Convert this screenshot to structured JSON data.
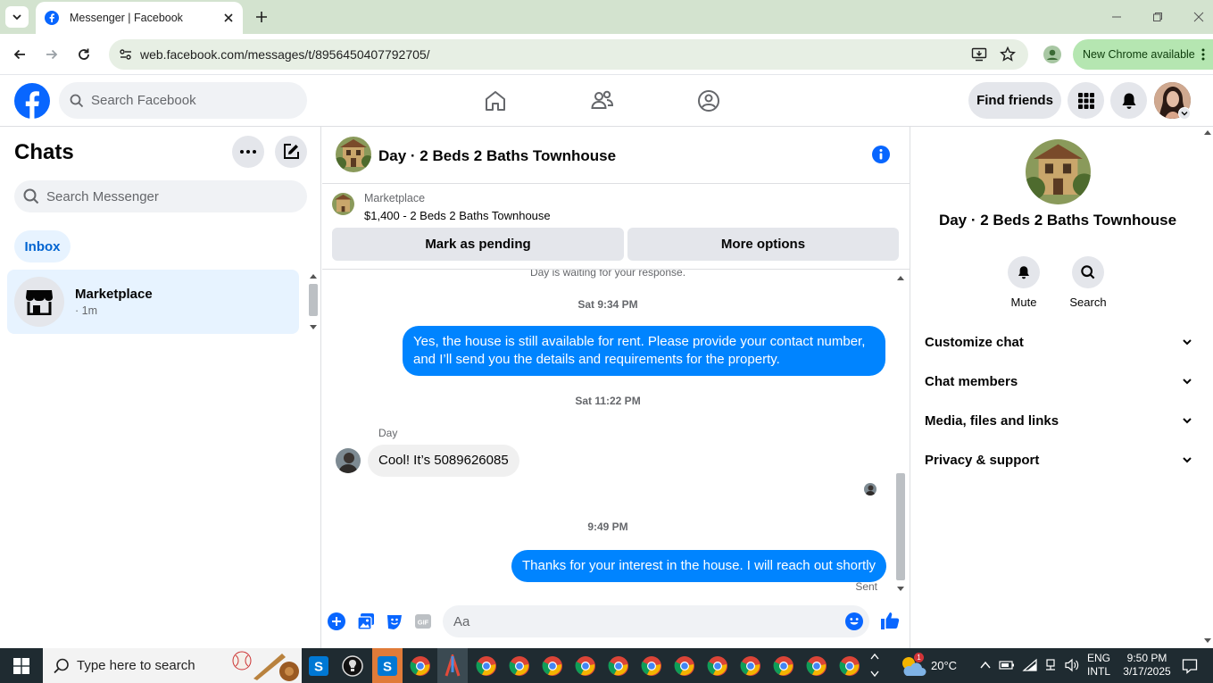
{
  "browser": {
    "tab_title": "Messenger | Facebook",
    "url": "web.facebook.com/messages/t/8956450407792705/",
    "update_label": "New Chrome available"
  },
  "fb_header": {
    "search_placeholder": "Search Facebook",
    "find_friends": "Find friends"
  },
  "chats": {
    "title": "Chats",
    "search_placeholder": "Search Messenger",
    "filter": "Inbox",
    "items": [
      {
        "name": "Marketplace",
        "time": "· 1m"
      }
    ]
  },
  "conversation": {
    "title": "Day · 2 Beds 2 Baths Townhouse",
    "marketplace_label": "Marketplace",
    "listing": "$1,400 - 2 Beds 2 Baths Townhouse",
    "btn_pending": "Mark as pending",
    "btn_more": "More options",
    "system_note": "Day is waiting for your response.",
    "messages": [
      {
        "stamp": "Sat 9:34 PM"
      },
      {
        "from": "me",
        "text": "Yes, the house is still available for rent. Please provide your contact number, and I’ll send you the details and requirements for the property."
      },
      {
        "stamp": "Sat 11:22 PM"
      },
      {
        "sender": "Day"
      },
      {
        "from": "them",
        "text": "Cool! It’s 5089626085"
      },
      {
        "stamp": "9:49 PM"
      },
      {
        "from": "me",
        "text": "Thanks for your interest in the house. I will reach out shortly"
      }
    ],
    "sent_label": "Sent",
    "composer_placeholder": "Aa"
  },
  "right_panel": {
    "title": "Day · 2 Beds 2 Baths Townhouse",
    "actions": [
      "Mute",
      "Search"
    ],
    "sections": [
      "Customize chat",
      "Chat members",
      "Media, files and links",
      "Privacy & support"
    ]
  },
  "taskbar": {
    "search_placeholder": "Type here to search",
    "temperature": "20°C",
    "lang_line1": "ENG",
    "lang_line2": "INTL",
    "time": "9:50 PM",
    "date": "3/17/2025",
    "weather_badge": "1"
  },
  "colors": {
    "fb_blue": "#0866ff",
    "messenger_blue": "#0084ff",
    "chrome_frame": "#d3e3cf",
    "update_green": "#b5e6b1"
  }
}
